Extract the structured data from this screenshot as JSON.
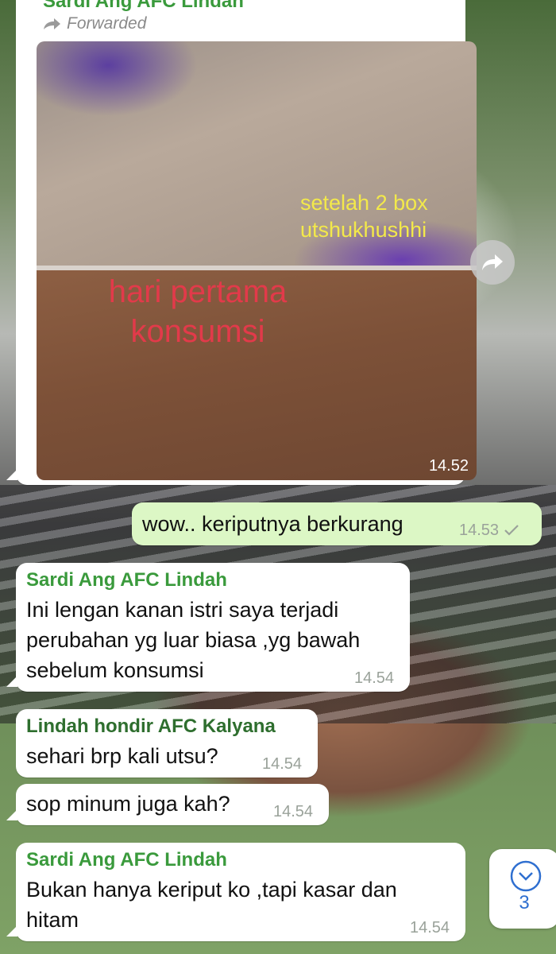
{
  "chat": {
    "forwarded_message": {
      "sender": "Sardi Ang AFC Lindah",
      "forwarded_label": "Forwarded",
      "caption_after": "setelah 2 box\nutshukhushhi",
      "caption_before": "hari pertama\nkonsumsi",
      "time": "14.52"
    },
    "outgoing": {
      "text": "wow.. keriputnya berkurang",
      "time": "14.53",
      "status_icon": "single-check-icon"
    },
    "incoming_1": {
      "sender": "Sardi Ang AFC Lindah",
      "text": "Ini lengan kanan istri saya terjadi perubahan yg luar biasa ,yg bawah sebelum konsumsi",
      "time": "14.54"
    },
    "incoming_2": {
      "sender": "Lindah hondir AFC Kalyana",
      "text": "sehari brp kali utsu?",
      "time": "14.54"
    },
    "incoming_3": {
      "text": "sop minum juga kah?",
      "time": "14.54"
    },
    "incoming_4": {
      "sender": "Sardi Ang AFC Lindah",
      "text": "Bukan hanya keriput ko ,tapi kasar dan hitam",
      "time": "14.54"
    },
    "scroll_down": {
      "icon": "chevron-down-circle-icon",
      "unread_count": "3"
    },
    "share": {
      "icon": "share-arrow-icon"
    }
  },
  "colors": {
    "sender_green": "#3a9a3c",
    "outgoing_bubble": "#dcf7c5",
    "incoming_bubble": "#ffffff",
    "accent_blue": "#2f6fd0"
  }
}
